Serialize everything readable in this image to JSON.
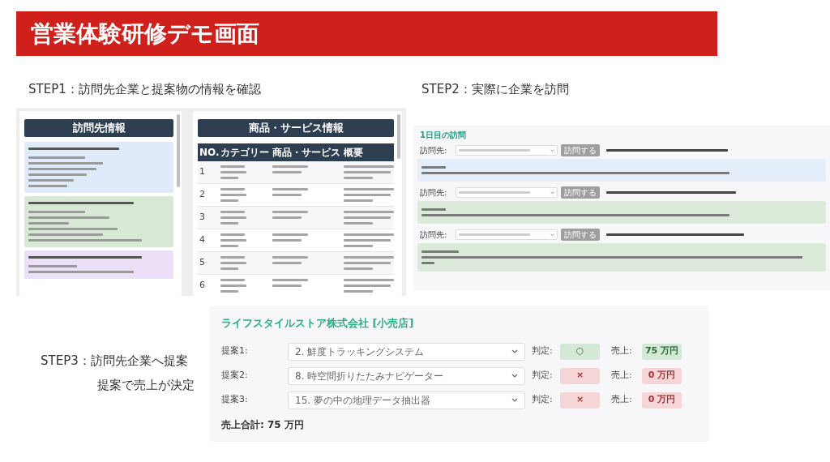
{
  "title": "営業体験研修デモ画面",
  "step1": {
    "caption": "STEP1：訪問先企業と提案物の情報を確認",
    "companies_panel": {
      "heading": "訪問先情報"
    },
    "products_panel": {
      "heading": "商品・サービス情報",
      "columns": [
        "NO.",
        "カテゴリー",
        "商品・サービス",
        "概要"
      ],
      "rows": [
        {
          "no": "1"
        },
        {
          "no": "2"
        },
        {
          "no": "3"
        },
        {
          "no": "4"
        },
        {
          "no": "5"
        },
        {
          "no": "6"
        }
      ]
    }
  },
  "step2": {
    "caption": "STEP2：実際に企業を訪問",
    "day_heading": "1日目の訪問",
    "visits": [
      {
        "label": "訪問先:",
        "button": "訪問する",
        "color": "#e4eefa"
      },
      {
        "label": "訪問先:",
        "button": "訪問する",
        "color": "#dcebd9"
      },
      {
        "label": "訪問先:",
        "button": "訪問する",
        "color": "#dcebd9"
      }
    ]
  },
  "step3": {
    "caption": "STEP3：訪問先企業へ提案",
    "subcaption": "提案で売上が決定",
    "company": "ライフスタイルストア株式会社 [小売店]",
    "proposals": [
      {
        "label": "提案1:",
        "value": "2. 鮮度トラッキングシステム",
        "judgement_label": "判定:",
        "judgement": "○",
        "kind": "ok",
        "sales_label": "売上:",
        "sales": "75 万円"
      },
      {
        "label": "提案2:",
        "value": "8. 時空間折りたたみナビゲーター",
        "judgement_label": "判定:",
        "judgement": "×",
        "kind": "ng",
        "sales_label": "売上:",
        "sales": "0 万円"
      },
      {
        "label": "提案3:",
        "value": "15. 夢の中の地理データ抽出器",
        "judgement_label": "判定:",
        "judgement": "×",
        "kind": "ng",
        "sales_label": "売上:",
        "sales": "0 万円"
      }
    ],
    "total": "売上合計: 75 万円"
  }
}
